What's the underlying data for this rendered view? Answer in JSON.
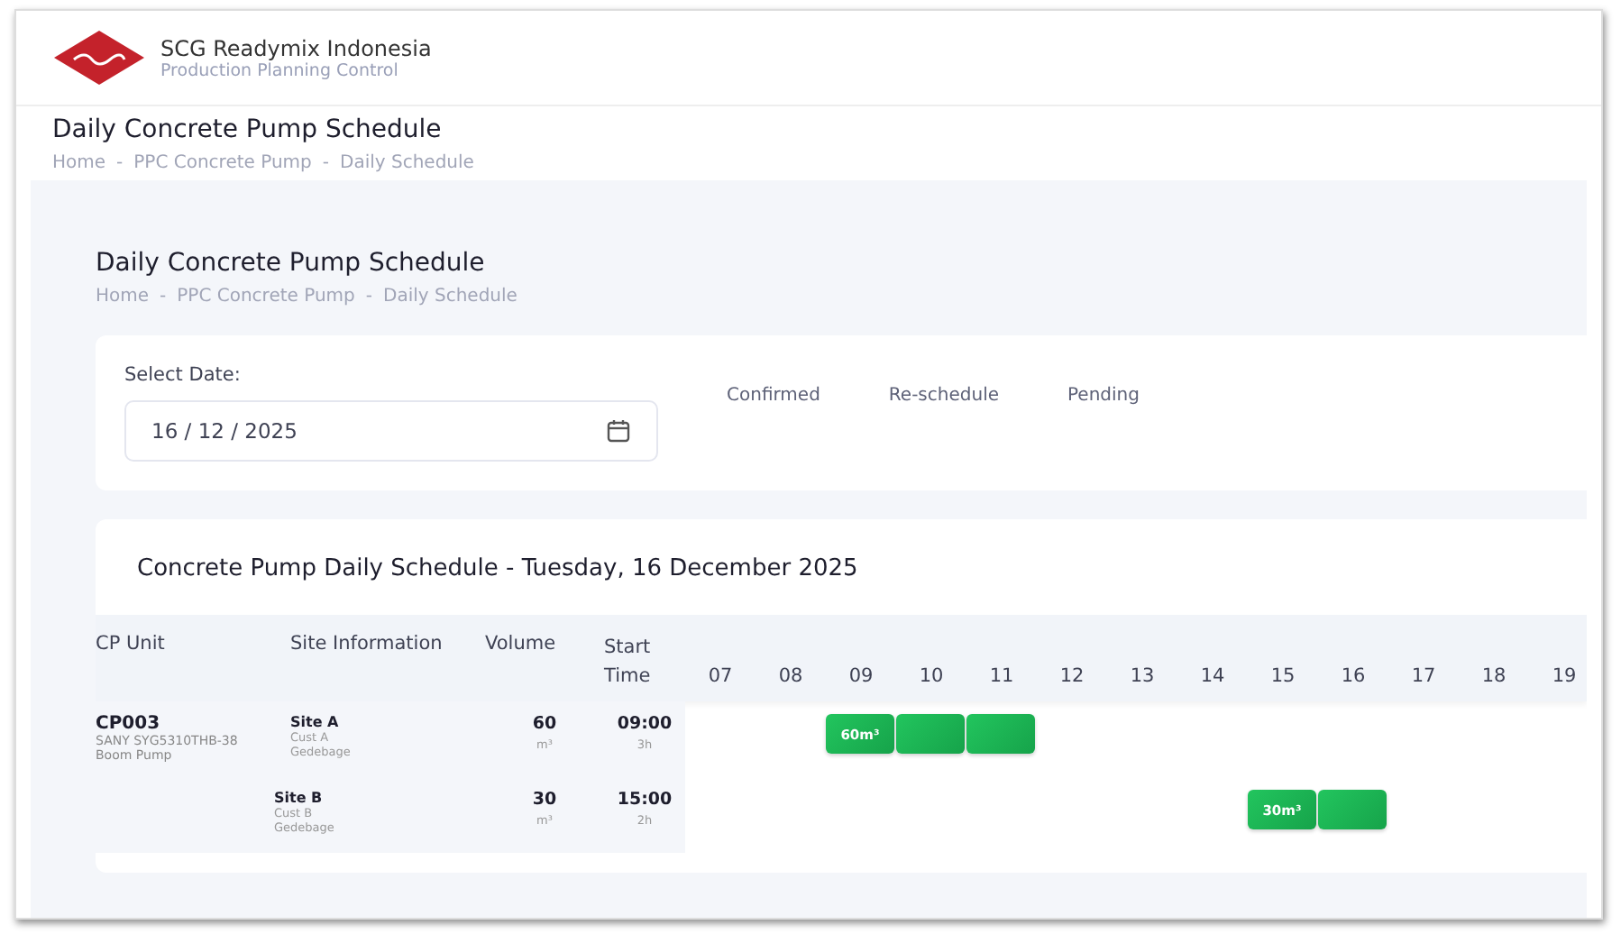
{
  "brand": {
    "name": "SCG Readymix Indonesia",
    "subtitle": "Production Planning Control"
  },
  "page": {
    "title": "Daily Concrete Pump Schedule",
    "breadcrumb": [
      "Home",
      "PPC Concrete Pump",
      "Daily Schedule"
    ],
    "breadcrumb_separator": "-"
  },
  "content": {
    "title": "Daily Concrete Pump Schedule",
    "breadcrumb": [
      "Home",
      "PPC Concrete Pump",
      "Daily Schedule"
    ],
    "breadcrumb_separator": "-"
  },
  "filter": {
    "label": "Select Date:",
    "date": {
      "value": "16 / 12 / 2025"
    },
    "legend": [
      "Confirmed",
      "Re-schedule",
      "Pending"
    ]
  },
  "schedule": {
    "title": "Concrete Pump Daily Schedule - Tuesday, 16 December 2025",
    "columns": [
      "CP Unit",
      "Site Information",
      "Volume",
      "Start Time"
    ],
    "hours": [
      "07",
      "08",
      "09",
      "10",
      "11",
      "12",
      "13",
      "14",
      "15",
      "16",
      "17",
      "18",
      "19"
    ],
    "units": [
      {
        "code": "CP003",
        "model": "SANY SYG5310THB-38",
        "type": "Boom Pump",
        "jobs": [
          {
            "site": "Site A",
            "customer": "Cust A",
            "location": "Gedebage",
            "volume": "60",
            "unit": "m³",
            "start": "09:00",
            "duration": "3h",
            "bar_label": "60m³"
          },
          {
            "site": "Site B",
            "customer": "Cust B",
            "location": "Gedebage",
            "volume": "30",
            "unit": "m³",
            "start": "15:00",
            "duration": "2h",
            "bar_label": "30m³"
          }
        ]
      }
    ]
  }
}
